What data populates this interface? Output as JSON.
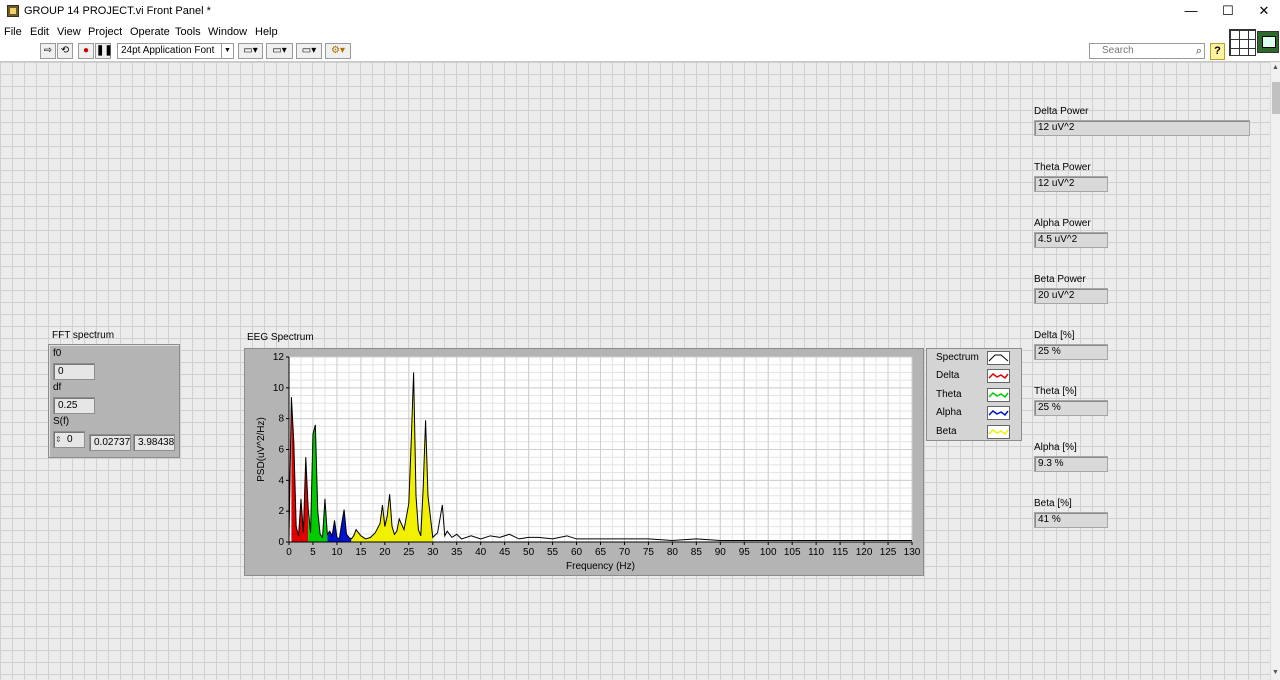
{
  "window": {
    "title": "GROUP 14 PROJECT.vi Front Panel *",
    "minimize": "—",
    "maximize": "☐",
    "close": "✕"
  },
  "menu": [
    "File",
    "Edit",
    "View",
    "Project",
    "Operate",
    "Tools",
    "Window",
    "Help"
  ],
  "toolbar": {
    "font": "24pt Application Font",
    "search_placeholder": "Search",
    "help": "?"
  },
  "cluster": {
    "label": "FFT spectrum",
    "f0_label": "f0",
    "f0": "0",
    "df_label": "df",
    "df": "0.25",
    "sf_label": "S(f)",
    "sf_index": "0",
    "sf_values": [
      "0.027373",
      "3.98438"
    ]
  },
  "indicators": [
    {
      "label": "Delta Power",
      "value": "12 uV^2"
    },
    {
      "label": "Theta Power",
      "value": "12 uV^2"
    },
    {
      "label": "Alpha Power",
      "value": "4.5 uV^2"
    },
    {
      "label": "Beta Power",
      "value": "20 uV^2"
    },
    {
      "label": "Delta [%]",
      "value": "25 %"
    },
    {
      "label": "Theta [%]",
      "value": "25 %"
    },
    {
      "label": "Alpha [%]",
      "value": "9.3 %"
    },
    {
      "label": "Beta [%]",
      "value": "41 %"
    }
  ],
  "chart_data": {
    "type": "area",
    "title": "EEG Spectrum",
    "xlabel": "Frequency (Hz)",
    "ylabel": "PSD(uV^2/Hz)",
    "xlim": [
      0,
      130
    ],
    "ylim": [
      0,
      12
    ],
    "xticks": [
      0,
      5,
      10,
      15,
      20,
      25,
      30,
      35,
      40,
      45,
      50,
      55,
      60,
      65,
      70,
      75,
      80,
      85,
      90,
      95,
      100,
      105,
      110,
      115,
      120,
      125,
      130
    ],
    "yticks": [
      0,
      2,
      4,
      6,
      8,
      10,
      12
    ],
    "grid": true,
    "legend": "right-outside",
    "series": [
      {
        "name": "Spectrum",
        "color": "#000000",
        "fill": "none",
        "x": [
          0,
          0.5,
          1,
          1.5,
          2,
          2.5,
          3,
          3.5,
          4,
          4.5,
          5,
          5.5,
          6,
          6.5,
          7,
          7.5,
          8,
          8.5,
          9,
          9.5,
          10,
          10.5,
          11,
          11.5,
          12,
          12.5,
          13,
          13.5,
          14,
          15,
          16,
          17,
          18,
          19,
          19.5,
          20,
          20.5,
          21,
          21.5,
          22,
          22.5,
          23,
          24,
          25,
          25.5,
          26,
          26.5,
          27,
          27.5,
          28,
          28.5,
          29,
          30,
          31,
          32,
          32.5,
          33,
          34,
          35,
          36,
          38,
          40,
          42,
          44,
          46,
          48,
          50,
          52,
          55,
          58,
          60,
          65,
          70,
          75,
          80,
          85,
          90,
          95,
          100,
          105,
          110,
          115,
          120,
          125,
          130
        ],
        "y": [
          0.3,
          9.4,
          6.5,
          1.0,
          0.4,
          2.8,
          0.6,
          5.5,
          2.2,
          0.6,
          7.0,
          7.6,
          2.0,
          0.5,
          0.3,
          2.8,
          0.5,
          0.7,
          0.4,
          1.4,
          0.3,
          0.2,
          1.2,
          2.1,
          0.5,
          0.3,
          0.2,
          0.4,
          0.8,
          0.4,
          0.2,
          0.3,
          0.6,
          1.2,
          2.4,
          1.0,
          1.7,
          3.1,
          1.0,
          0.5,
          0.7,
          1.5,
          0.8,
          2.5,
          6.5,
          11.0,
          3.0,
          0.8,
          0.4,
          3.5,
          7.9,
          3.0,
          0.3,
          0.6,
          2.4,
          0.4,
          0.7,
          0.3,
          0.5,
          0.2,
          0.4,
          0.2,
          0.4,
          0.3,
          0.5,
          0.2,
          0.3,
          0.3,
          0.2,
          0.4,
          0.2,
          0.2,
          0.2,
          0.2,
          0.1,
          0.2,
          0.1,
          0.1,
          0.1,
          0.1,
          0.1,
          0.1,
          0.1,
          0.1,
          0.1
        ]
      },
      {
        "name": "Delta",
        "color": "#e00000",
        "range": [
          0.5,
          4
        ]
      },
      {
        "name": "Theta",
        "color": "#00cc00",
        "range": [
          4,
          8
        ]
      },
      {
        "name": "Alpha",
        "color": "#0010d0",
        "range": [
          8,
          13
        ]
      },
      {
        "name": "Beta",
        "color": "#f0f000",
        "range": [
          13,
          30
        ]
      }
    ]
  }
}
